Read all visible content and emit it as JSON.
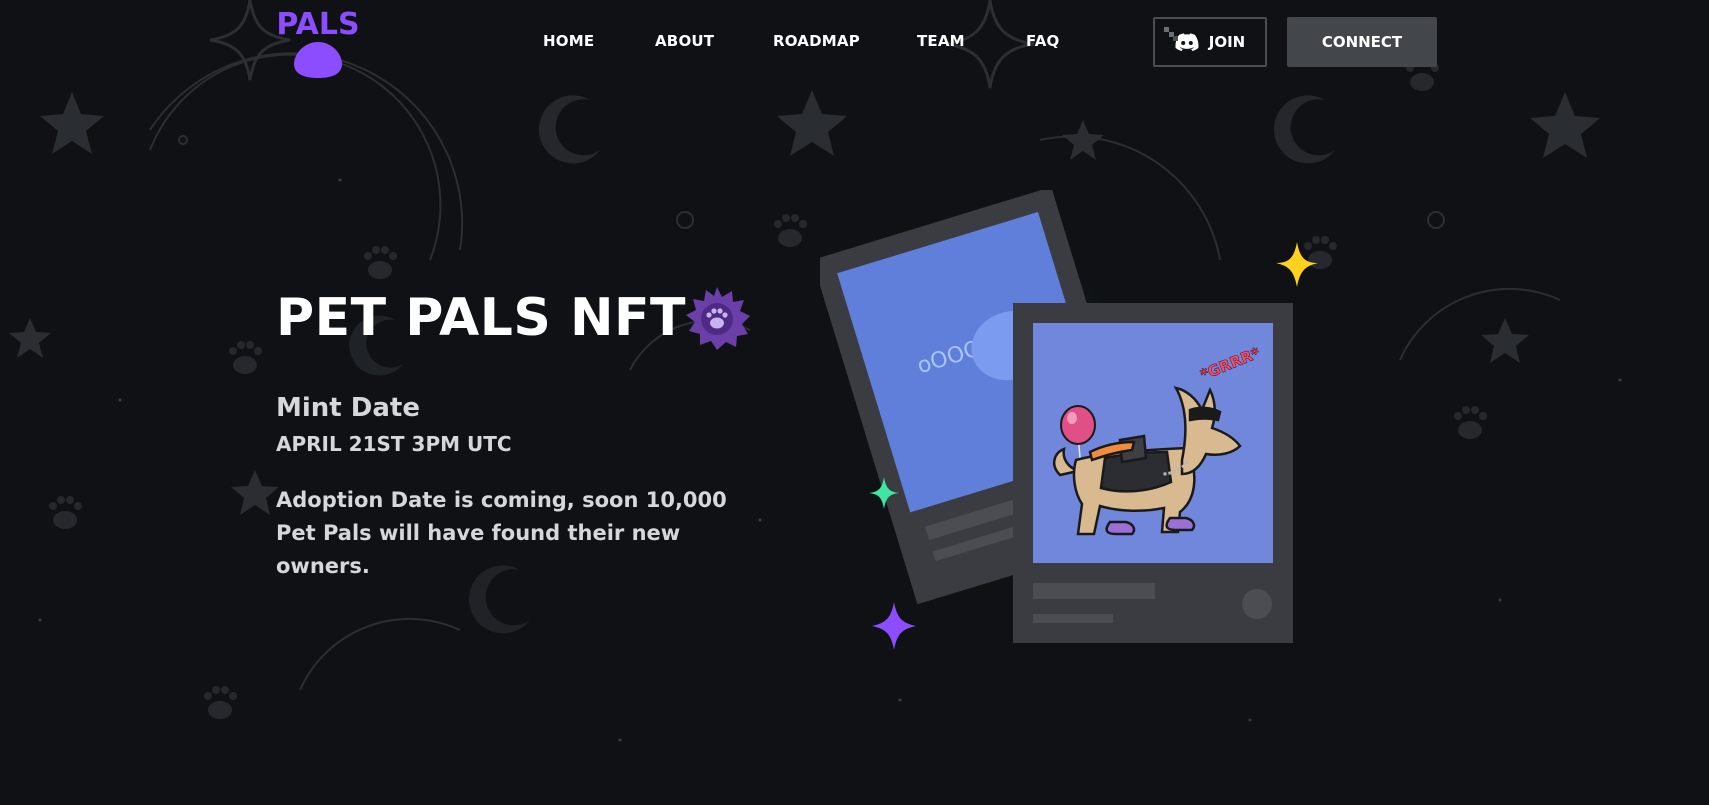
{
  "header": {
    "logo_text": "PALS",
    "nav": [
      {
        "label": "HOME"
      },
      {
        "label": "ABOUT"
      },
      {
        "label": "ROADMAP"
      },
      {
        "label": "TEAM"
      },
      {
        "label": "FAQ"
      }
    ],
    "join_label": "JOIN",
    "connect_label": "CONNECT"
  },
  "hero": {
    "title": "PET PALS NFT",
    "mint_label": "Mint Date",
    "mint_date": "APRIL 21ST 3PM UTC",
    "description": "Adoption Date is coming, soon 10,000 Pet Pals will have found their new owners."
  },
  "art": {
    "speech_text": "*GRRR*"
  },
  "colors": {
    "background": "#0f1114",
    "accent_purple": "#8b4dff",
    "card_blue": "#6f86e0",
    "sparkle_yellow": "#ffd21f",
    "sparkle_green": "#3ee6a2",
    "button_gray": "#43474c"
  },
  "icons": [
    "paw-logo-icon",
    "discord-icon",
    "paw-badge-icon",
    "sparkle-icon",
    "balloon-icon",
    "dog-icon"
  ]
}
